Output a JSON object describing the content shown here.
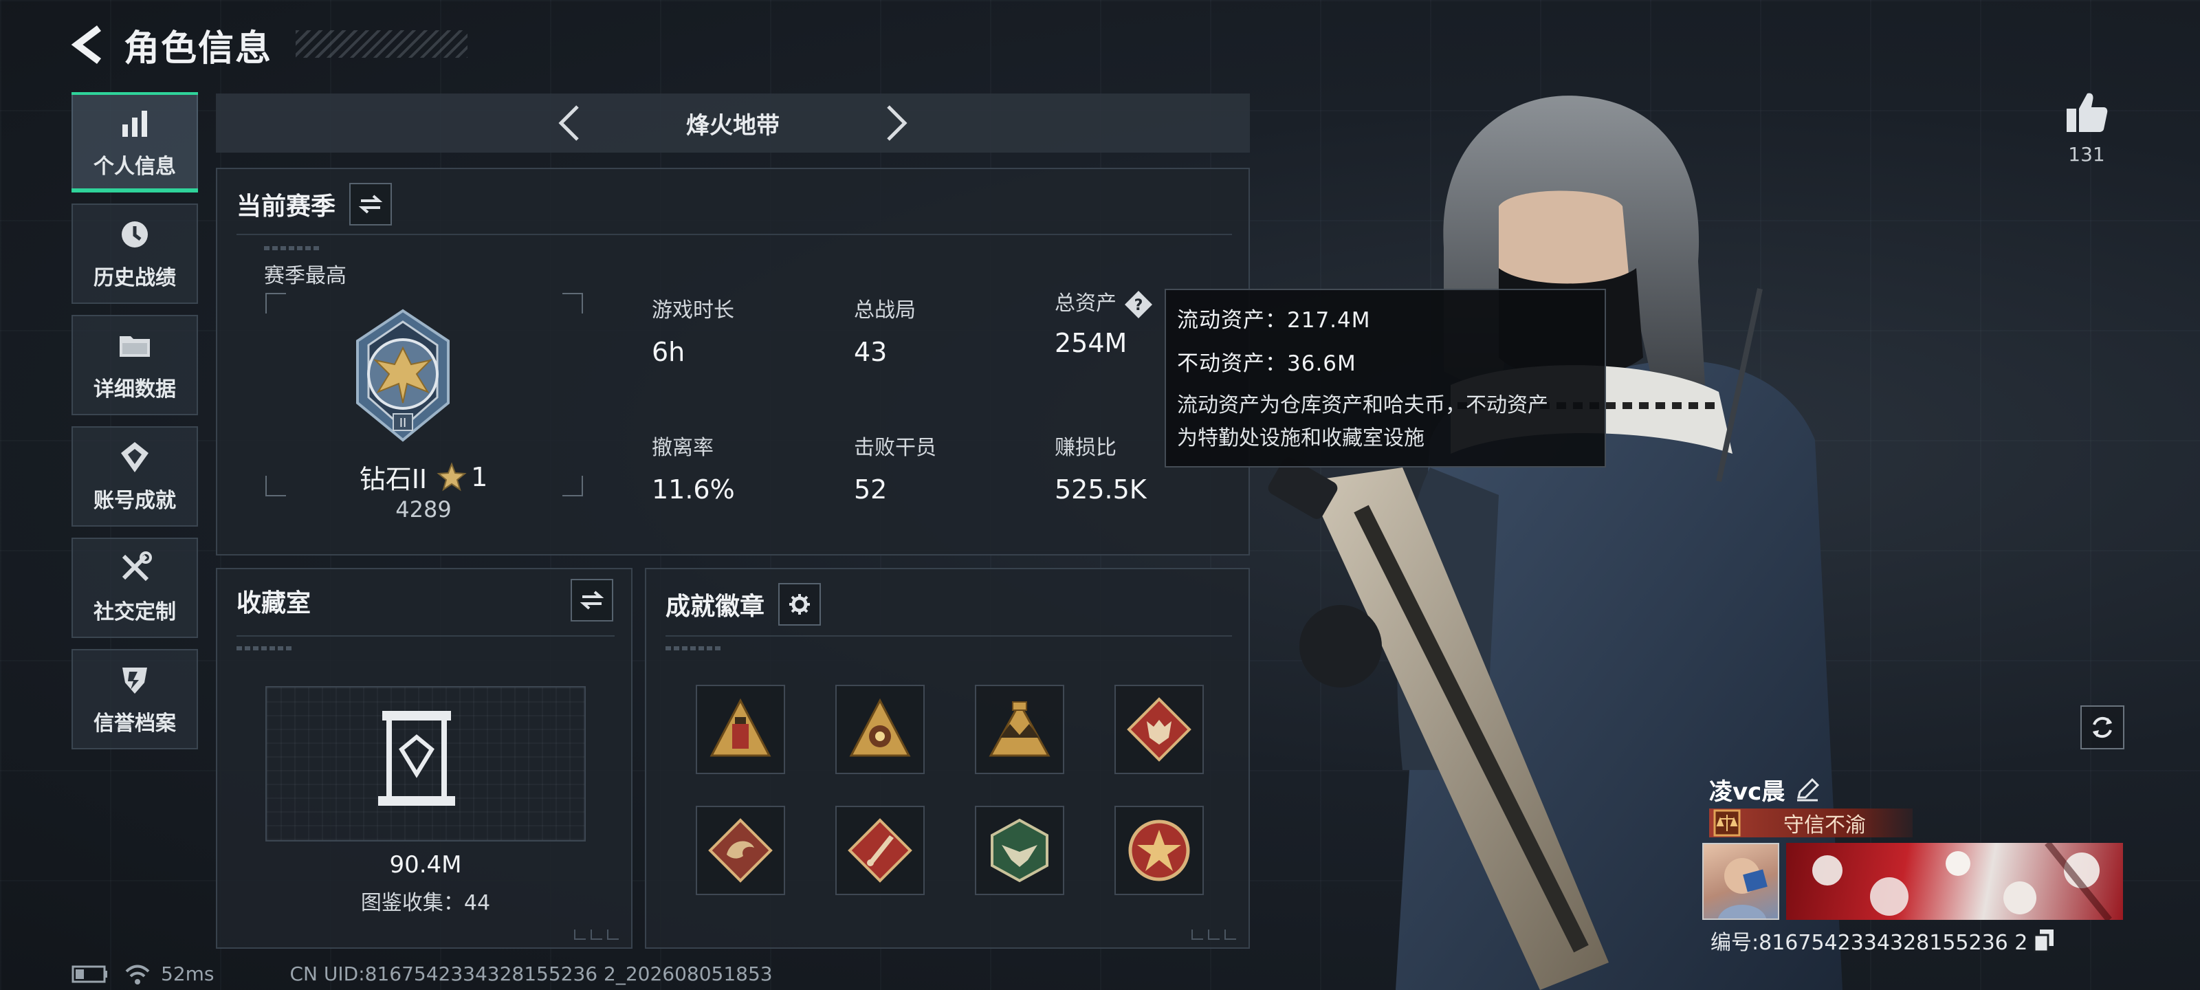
{
  "header": {
    "title": "角色信息"
  },
  "sidebar": {
    "items": [
      {
        "label": "个人信息",
        "icon": "bar-chart-icon"
      },
      {
        "label": "历史战绩",
        "icon": "history-icon"
      },
      {
        "label": "详细数据",
        "icon": "folder-icon"
      },
      {
        "label": "账号成就",
        "icon": "achievement-icon"
      },
      {
        "label": "社交定制",
        "icon": "tools-icon"
      },
      {
        "label": "信誉档案",
        "icon": "shield-icon"
      }
    ]
  },
  "mode": {
    "title": "烽火地带"
  },
  "season": {
    "title": "当前赛季",
    "best_label": "赛季最高",
    "rank_name": "钻石II",
    "rank_stars": "1",
    "rank_score": "4289",
    "stats": {
      "playtime": {
        "label": "游戏时长",
        "value": "6h"
      },
      "matches": {
        "label": "总战局",
        "value": "43"
      },
      "assets": {
        "label": "总资产",
        "value": "254M"
      },
      "extract_rate": {
        "label": "撤离率",
        "value": "11.6%"
      },
      "kills": {
        "label": "击败干员",
        "value": "52"
      },
      "profit_ratio": {
        "label": "赚损比",
        "value": "525.5K"
      }
    }
  },
  "tooltip": {
    "liquid": "流动资产：217.4M",
    "fixed": "不动资产：36.6M",
    "desc_1": "流动资产为仓库资产和哈夫币，不动资产",
    "desc_2": "为特勤处设施和收藏室设施"
  },
  "collection": {
    "title": "收藏室",
    "value": "90.4M",
    "count_text": "图鉴收集：44"
  },
  "achievements": {
    "title": "成就徽章",
    "badges": [
      "badge-tower",
      "badge-eye",
      "badge-crown",
      "badge-wolf",
      "badge-dragon",
      "badge-blade",
      "badge-hawk",
      "badge-star"
    ]
  },
  "profile": {
    "likes": "131",
    "name": "凌vc晨",
    "credit_title": "守信不渝",
    "id_text": "编号:8167542334328155236 2"
  },
  "footer": {
    "ping": "52ms",
    "uid": "CN UID:8167542334328155236 2_202608051853"
  },
  "colors": {
    "accent": "#2fd39a",
    "credit_red": "#a33b2e",
    "badge_red": "#a5322b",
    "badge_gold": "#c89b4a"
  }
}
